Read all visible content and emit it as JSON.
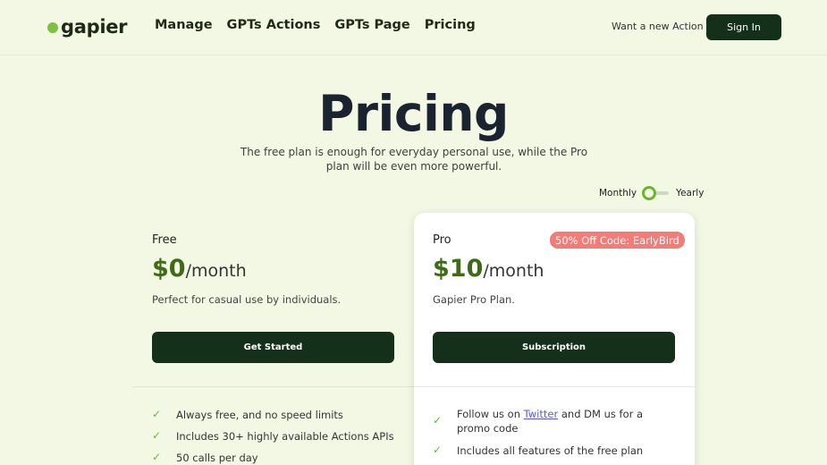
{
  "header": {
    "logo_text": "gapier",
    "nav": [
      "Manage",
      "GPTs Actions",
      "GPTs Page",
      "Pricing"
    ],
    "want_action": "Want a new Action +",
    "sign_in": "Sign In"
  },
  "hero": {
    "title": "Pricing",
    "subtitle": "The free plan is enough for everyday personal use, while the Pro plan will be even more powerful."
  },
  "billing_toggle": {
    "monthly": "Monthly",
    "yearly": "Yearly",
    "selected": "Monthly"
  },
  "plans": {
    "free": {
      "name": "Free",
      "price": "$0",
      "period": "/month",
      "description": "Perfect for casual use by individuals.",
      "cta": "Get Started",
      "features": [
        "Always free, and no speed limits",
        "Includes 30+ highly available Actions APIs",
        "50 calls per day"
      ]
    },
    "pro": {
      "name": "Pro",
      "badge": "50% Off Code: EarlyBird",
      "price": "$10",
      "period": "/month",
      "description": "Gapier Pro Plan.",
      "cta": "Subscription",
      "feature1_before": "Follow us on",
      "feature1_link": "Twitter",
      "feature1_after": "and DM us for a promo code",
      "feature2": "Includes all features of the free plan"
    }
  },
  "colors": {
    "background": "#f2f8e4",
    "primary_dark": "#14301a",
    "accent_green": "#6bb52e",
    "price_green": "#3f6b19",
    "badge_red": "#f47b76",
    "link_blue": "#5a5ad6"
  },
  "icons": {
    "feature_bullet": "check-icon"
  }
}
